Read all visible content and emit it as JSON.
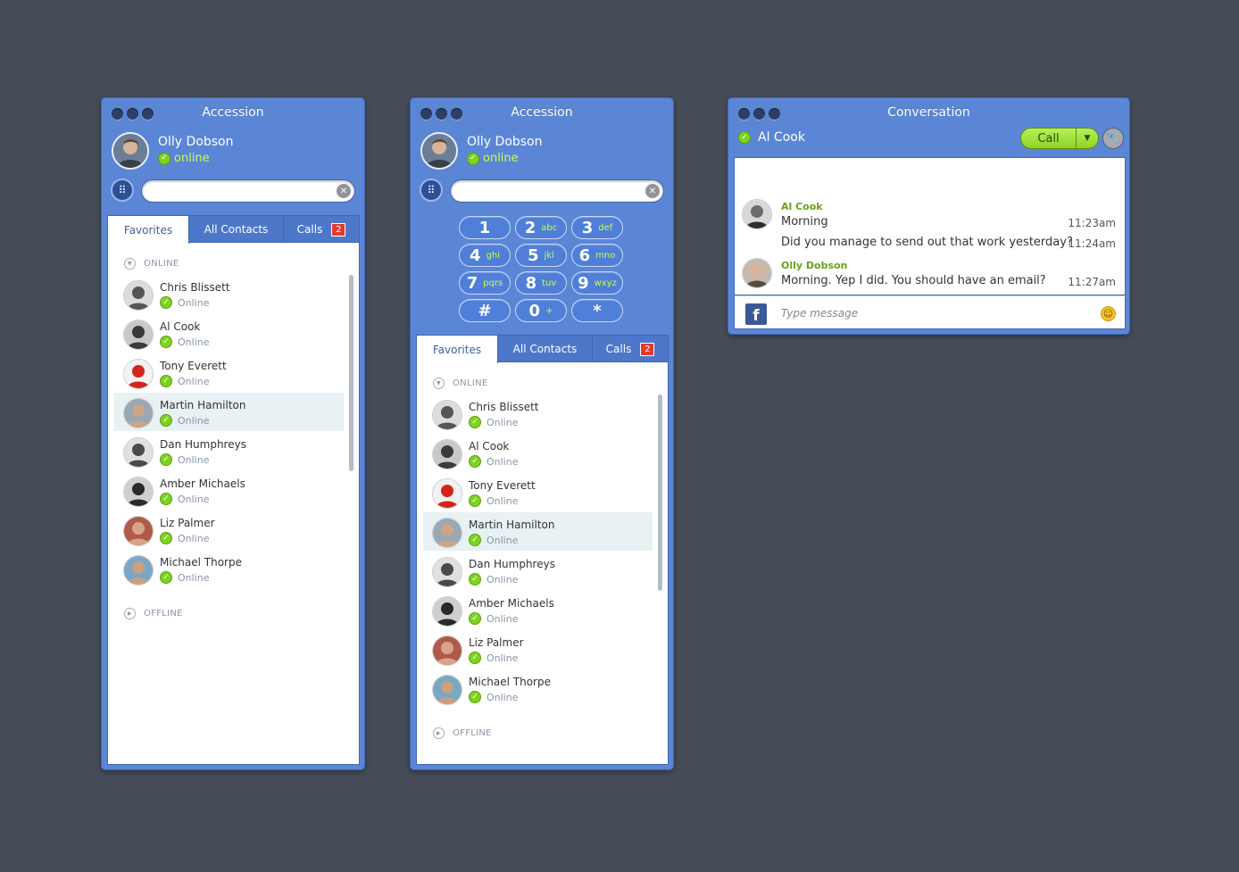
{
  "colors": {
    "background": "#454c57",
    "window": "#5b86d6",
    "accent_green": "#c9ff3a",
    "status_online": "#7ed321",
    "badge": "#e23a2e"
  },
  "icons": {
    "check": "✓",
    "keypad": "⠿",
    "clear": "✕",
    "caret_down": "▼",
    "caret_right": "▶",
    "settings": "🔧",
    "dropdown": "▼",
    "smiley": "☺",
    "facebook": "f"
  },
  "accession": {
    "title": "Accession",
    "user": {
      "name": "Olly Dobson",
      "status": "online"
    },
    "search": {
      "value": "",
      "placeholder": ""
    },
    "tabs": [
      {
        "label": "Favorites"
      },
      {
        "label": "All Contacts"
      },
      {
        "label": "Calls",
        "badge": "2"
      }
    ],
    "sections": {
      "online": "ONLINE",
      "offline": "OFFLINE"
    },
    "contacts": [
      {
        "name": "Chris Blissett",
        "status": "Online"
      },
      {
        "name": "Al Cook",
        "status": "Online"
      },
      {
        "name": "Tony Everett",
        "status": "Online"
      },
      {
        "name": "Martin Hamilton",
        "status": "Online"
      },
      {
        "name": "Dan Humphreys",
        "status": "Online"
      },
      {
        "name": "Amber Michaels",
        "status": "Online"
      },
      {
        "name": "Liz Palmer",
        "status": "Online"
      },
      {
        "name": "Michael Thorpe",
        "status": "Online"
      }
    ],
    "highlighted_contact": 3
  },
  "dialpad": [
    {
      "digit": "1",
      "letters": ""
    },
    {
      "digit": "2",
      "letters": "abc"
    },
    {
      "digit": "3",
      "letters": "def"
    },
    {
      "digit": "4",
      "letters": "ghi"
    },
    {
      "digit": "5",
      "letters": "jkl"
    },
    {
      "digit": "6",
      "letters": "mno"
    },
    {
      "digit": "7",
      "letters": "pqrs"
    },
    {
      "digit": "8",
      "letters": "tuv"
    },
    {
      "digit": "9",
      "letters": "wxyz"
    },
    {
      "digit": "#",
      "letters": ""
    },
    {
      "digit": "0",
      "letters": "+"
    },
    {
      "digit": "*",
      "letters": ""
    }
  ],
  "conversation": {
    "title": "Conversation",
    "contact": "Al Cook",
    "call_label": "Call",
    "messages": [
      {
        "sender": "Al Cook",
        "lines": [
          {
            "text": "Morning",
            "time": "11:23am"
          },
          {
            "text": "Did you manage to send out that work yesterday?",
            "time": "11:24am"
          }
        ]
      },
      {
        "sender": "Olly Dobson",
        "lines": [
          {
            "text": "Morning. Yep I did. You should have an email?",
            "time": "11:27am"
          }
        ]
      }
    ],
    "input_placeholder": "Type message"
  }
}
